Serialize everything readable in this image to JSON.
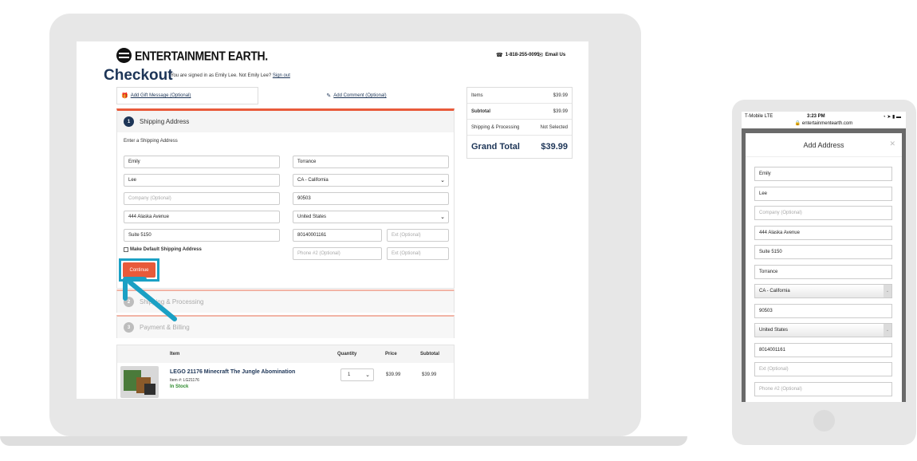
{
  "header": {
    "logo_text": "ENTERTAINMENT EARTH.",
    "phone": "1-818-255-0095",
    "email_label": "Email Us"
  },
  "checkout": {
    "title": "Checkout",
    "signed_in_text": "You are signed in as Emily Lee. Not Emily Lee?",
    "sign_out_label": "Sign out",
    "gift_message_label": "Add Gift Message (Optional)",
    "comment_label": "Add Comment (Optional)"
  },
  "shipping": {
    "step_number": "1",
    "step_title": "Shipping Address",
    "instruction": "Enter a Shipping Address",
    "first_name": "Emily",
    "last_name": "Lee",
    "company_placeholder": "Company (Optional)",
    "address1": "444 Alaska Avenue",
    "address2": "Suite 5150",
    "city": "Torrance",
    "state": "CA - California",
    "zip": "90503",
    "country": "United States",
    "phone": "80140001161",
    "ext_placeholder": "Ext (Optional)",
    "phone2_placeholder": "Phone #2 (Optional)",
    "ext2_placeholder": "Ext (Optional)",
    "default_checkbox_label": "Make Default Shipping Address",
    "continue_label": "Continue"
  },
  "steps": [
    {
      "number": "2",
      "title": "Shipping & Processing"
    },
    {
      "number": "3",
      "title": "Payment & Billing"
    }
  ],
  "summary": {
    "items_label": "Items",
    "items_value": "$39.99",
    "subtotal_label": "Subtotal",
    "subtotal_value": "$39.99",
    "shipping_label": "Shipping & Processing",
    "shipping_value": "Not Selected",
    "grand_label": "Grand Total",
    "grand_value": "$39.99"
  },
  "cart": {
    "columns": [
      "Item",
      "Quantity",
      "Price",
      "Subtotal"
    ],
    "item": {
      "name": "LEGO 21176 Minecraft The Jungle Abomination",
      "item_number": "Item #: LG21176",
      "stock": "In Stock",
      "quantity": "1",
      "price": "$39.99",
      "subtotal": "$39.99"
    }
  },
  "phone_ui": {
    "carrier": "T-Mobile  LTE",
    "time": "3:23 PM",
    "battery": "◔ ➤ ▮ ▬",
    "url": "entertainmentearth.com",
    "modal_title": "Add Address",
    "fields": [
      {
        "value": "Emily",
        "placeholder": false,
        "select": false
      },
      {
        "value": "Lee",
        "placeholder": false,
        "select": false
      },
      {
        "value": "Company (Optional)",
        "placeholder": true,
        "select": false
      },
      {
        "value": "444 Alaska Avenue",
        "placeholder": false,
        "select": false
      },
      {
        "value": "Suite 5150",
        "placeholder": false,
        "select": false
      },
      {
        "value": "Torrance",
        "placeholder": false,
        "select": false
      },
      {
        "value": "CA - California",
        "placeholder": false,
        "select": true
      },
      {
        "value": "90503",
        "placeholder": false,
        "select": false
      },
      {
        "value": "United States",
        "placeholder": false,
        "select": true
      },
      {
        "value": "8014001161",
        "placeholder": false,
        "select": false
      },
      {
        "value": "Ext (Optional)",
        "placeholder": true,
        "select": false
      },
      {
        "value": "Phone #2 (Optional)",
        "placeholder": true,
        "select": false
      }
    ]
  },
  "colors": {
    "navy": "#1d3557",
    "accent_orange": "#e85a3a",
    "highlight_blue": "#1ba0c4",
    "in_stock_green": "#2e8b2e"
  }
}
